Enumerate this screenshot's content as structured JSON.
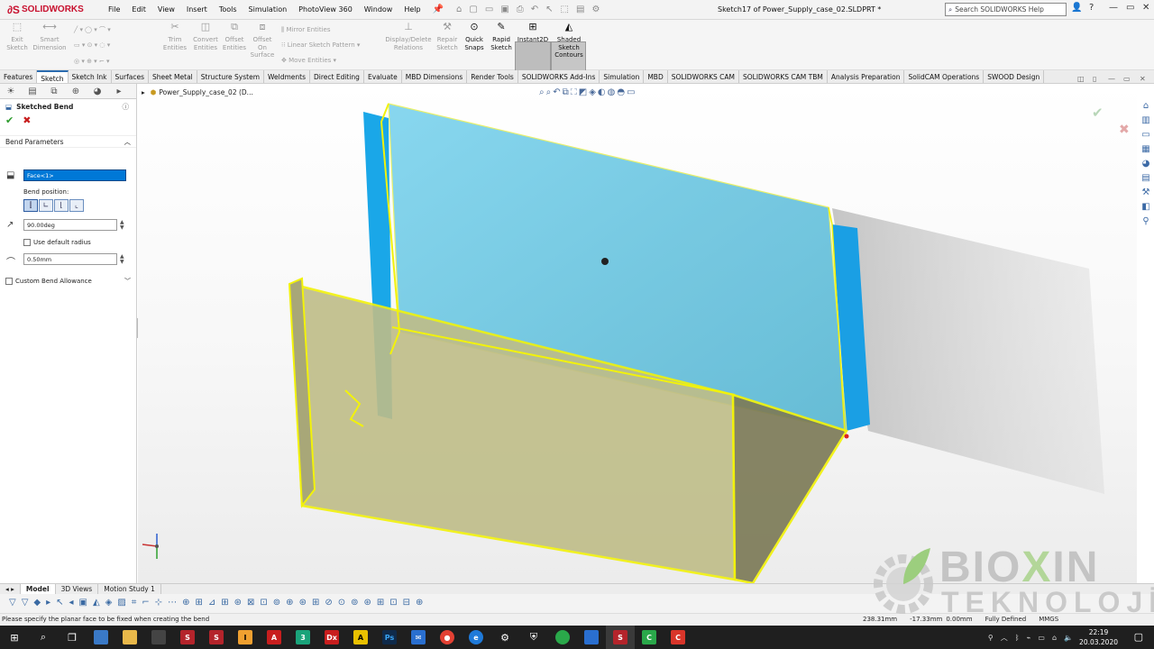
{
  "app": {
    "brand": "SOLIDWORKS",
    "menus": [
      "File",
      "Edit",
      "View",
      "Insert",
      "Tools",
      "Simulation",
      "PhotoView 360",
      "Window",
      "Help"
    ],
    "doc_title": "Sketch17 of Power_Supply_case_02.SLDPRT *",
    "search_placeholder": "Search SOLIDWORKS Help"
  },
  "ribbon": {
    "exit_sketch": "Exit Sketch",
    "smart_dimension": "Smart Dimension",
    "trim_entities": "Trim Entities",
    "convert_entities": "Convert Entities",
    "offset_entities": "Offset Entities",
    "offset_on_surface": "Offset On Surface",
    "mirror_entities": "Mirror Entities",
    "linear_sketch_pattern": "Linear Sketch Pattern",
    "move_entities": "Move Entities",
    "display_delete_relations": "Display/Delete Relations",
    "repair_sketch": "Repair Sketch",
    "quick_snaps": "Quick Snaps",
    "rapid_sketch": "Rapid Sketch",
    "instant2d": "Instant2D",
    "shaded_sketch_contours": "Shaded Sketch Contours"
  },
  "tabs": [
    "Features",
    "Sketch",
    "Sketch Ink",
    "Surfaces",
    "Sheet Metal",
    "Structure System",
    "Weldments",
    "Direct Editing",
    "Evaluate",
    "MBD Dimensions",
    "Render Tools",
    "SOLIDWORKS Add-Ins",
    "Simulation",
    "MBD",
    "SOLIDWORKS CAM",
    "SOLIDWORKS CAM TBM",
    "Analysis Preparation",
    "SolidCAM Operations",
    "SWOOD Design"
  ],
  "panel": {
    "title": "Sketched Bend",
    "section": "Bend Parameters",
    "face": "Face<1>",
    "bend_position_label": "Bend position:",
    "angle": "90.00deg",
    "use_default_radius": "Use default radius",
    "radius": "0.50mm",
    "custom_bend_allowance": "Custom Bend Allowance"
  },
  "tree": {
    "root": "Power_Supply_case_02  (D..."
  },
  "bottom_tabs": [
    "Model",
    "3D Views",
    "Motion Study 1"
  ],
  "status": {
    "message": "Please specify the planar face to be fixed when creating the bend",
    "x": "238.31mm",
    "y": "-17.33mm",
    "z": "0.00mm",
    "state": "Fully Defined",
    "units": "MMGS"
  },
  "clock": {
    "time": "22:19",
    "date": "20.03.2020"
  },
  "watermark": {
    "line1_a": "BIO",
    "line1_b": "X",
    "line1_c": "IN",
    "line2": "TEKNOLOJİ"
  },
  "colors": {
    "accent": "#0078d7",
    "sketch_yellow": "#f2f20a",
    "selected_face": "#5cc8e6"
  }
}
